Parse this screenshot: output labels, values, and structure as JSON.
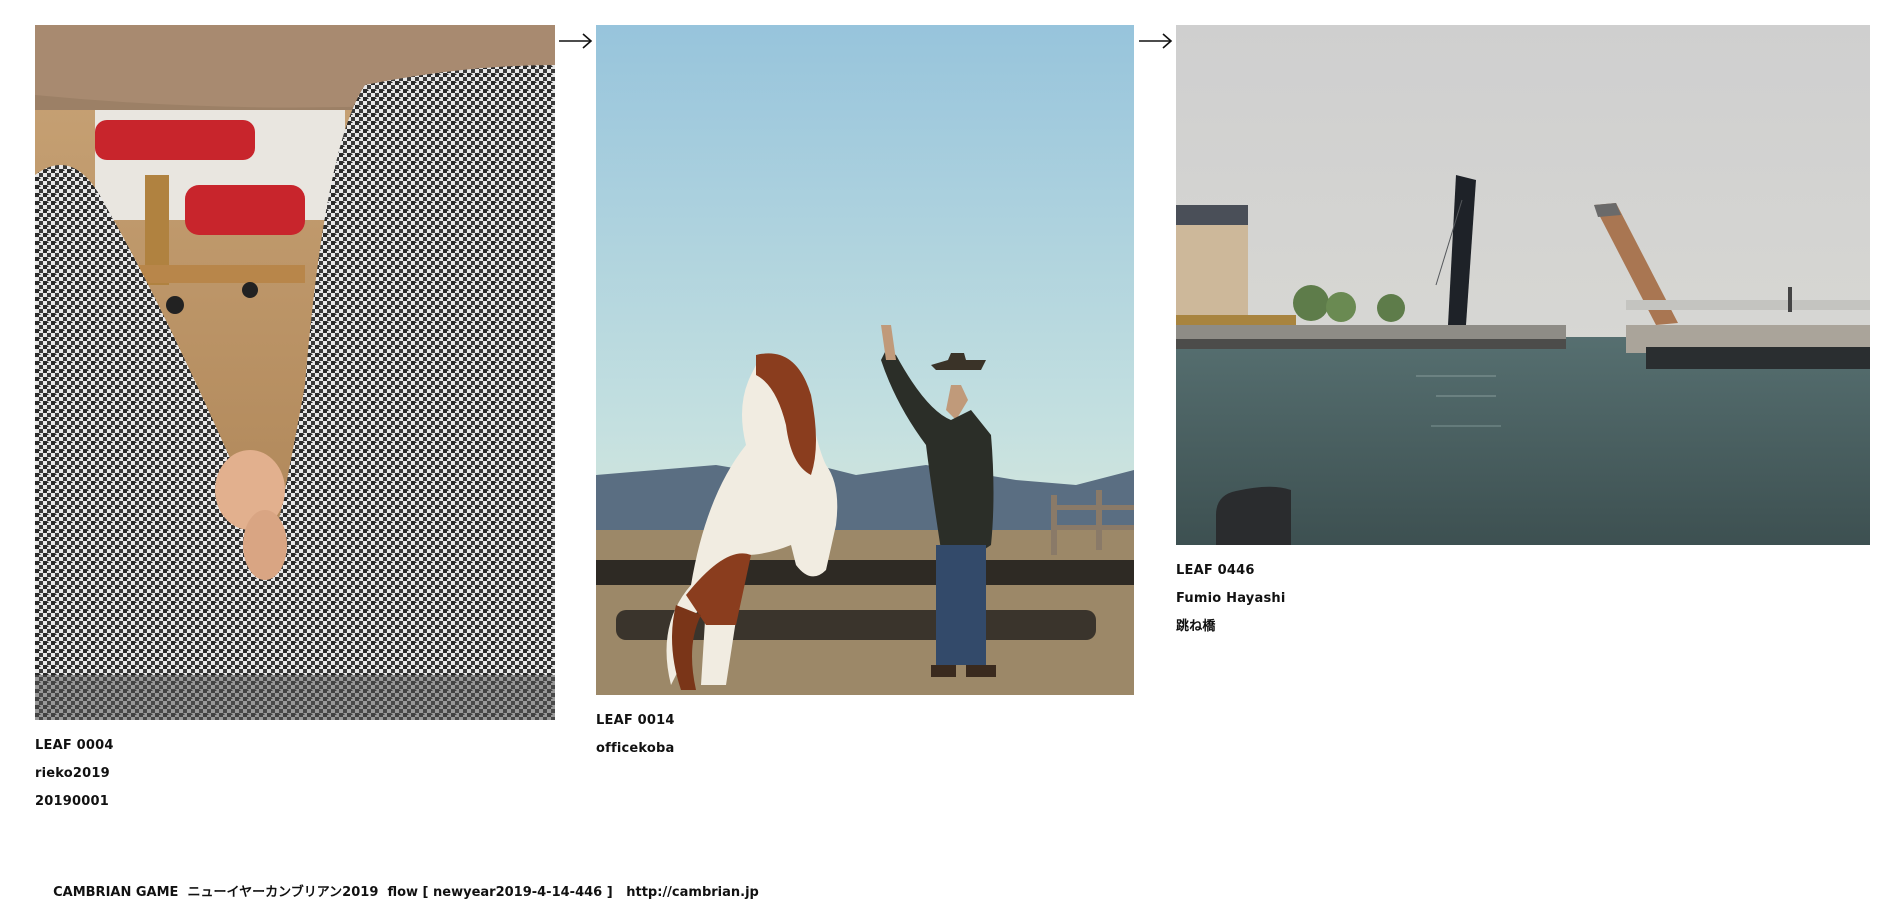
{
  "leaves": [
    {
      "id": "LEAF 0004",
      "author": "rieko2019",
      "title": "20190001"
    },
    {
      "id": "LEAF 0014",
      "author": "officekoba"
    },
    {
      "id": "LEAF 0446",
      "author": "Fumio Hayashi",
      "title": "跳ね橋"
    }
  ],
  "arrows": [
    "right-arrow-icon",
    "right-arrow-icon"
  ],
  "footer": {
    "game": "CAMBRIAN GAME",
    "event": "ニューイヤーカンブリアン2019",
    "flow": "flow [ newyear2019-4-14-446 ]",
    "url": "http://cambrian.jp"
  }
}
